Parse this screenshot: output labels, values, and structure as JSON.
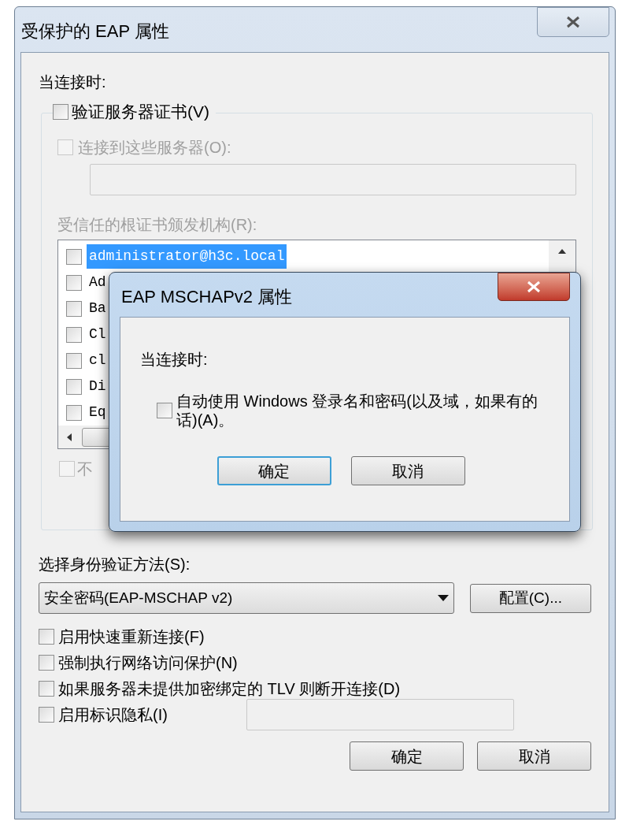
{
  "window": {
    "title": "受保护的 EAP 属性"
  },
  "connect_label": "当连接时:",
  "verify_cert": {
    "label": "验证服务器证书(V)",
    "checked": false
  },
  "connect_servers": {
    "label": "连接到这些服务器(O):",
    "checked": false,
    "disabled": true
  },
  "trusted_ca": {
    "label": "受信任的根证书颁发机构(R):",
    "disabled": true,
    "items": [
      {
        "name": "administrator@h3c.local",
        "checked": false,
        "selected": true
      },
      {
        "name": "Ad",
        "checked": false,
        "selected": false
      },
      {
        "name": "Ba",
        "checked": false,
        "selected": false
      },
      {
        "name": "Cl",
        "checked": false,
        "selected": false
      },
      {
        "name": "cl",
        "checked": false,
        "selected": false
      },
      {
        "name": "Di",
        "checked": false,
        "selected": false
      },
      {
        "name": "Eq",
        "checked": false,
        "selected": false
      }
    ]
  },
  "no_prompt": {
    "label": "不",
    "checked": false,
    "disabled": true
  },
  "auth_method": {
    "label": "选择身份验证方法(S):",
    "value": "安全密码(EAP-MSCHAP v2)"
  },
  "configure_button": "配置(C)...",
  "options": [
    {
      "label": "启用快速重新连接(F)",
      "checked": false
    },
    {
      "label": "强制执行网络访问保护(N)",
      "checked": false
    },
    {
      "label": "如果服务器未提供加密绑定的 TLV 则断开连接(D)",
      "checked": false
    },
    {
      "label": "启用标识隐私(I)",
      "checked": false
    }
  ],
  "buttons": [
    {
      "label": "确定",
      "default": false
    },
    {
      "label": "取消",
      "default": false
    }
  ],
  "dialog": {
    "title": "EAP MSCHAPv2 属性",
    "connect_label": "当连接时:",
    "auto_logon": {
      "label": "自动使用 Windows 登录名和密码(以及域，如果有的话)(A)。",
      "checked": false
    },
    "buttons": [
      {
        "label": "确定",
        "default": true
      },
      {
        "label": "取消",
        "default": false
      }
    ]
  }
}
